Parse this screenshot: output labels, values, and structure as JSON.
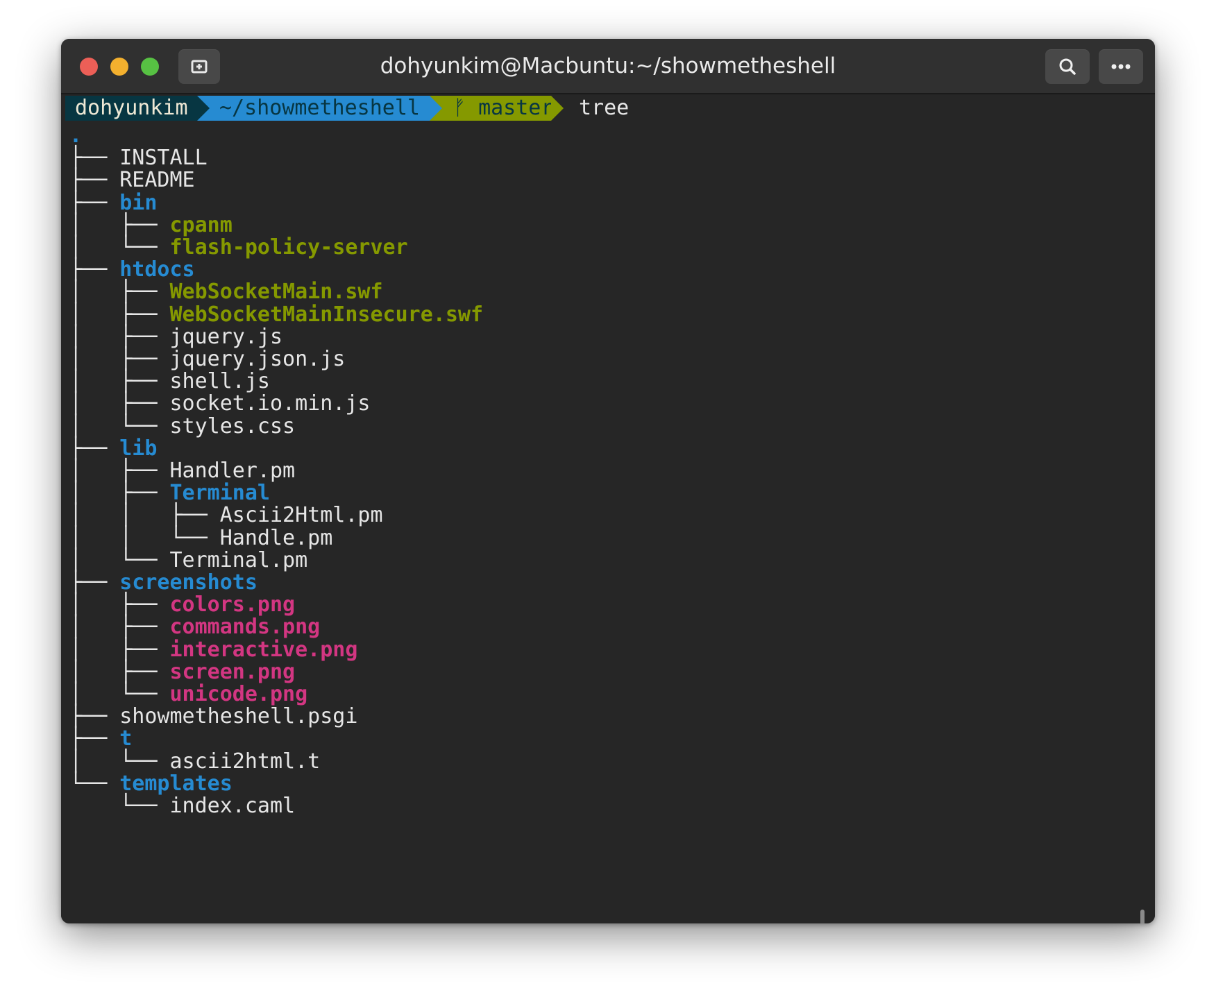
{
  "window": {
    "title": "dohyunkim@Macbuntu:~/showmetheshell"
  },
  "titlebar": {
    "buttons": {
      "close": "red-close-icon",
      "minimize": "yellow-minimize-icon",
      "maximize": "green-maximize-icon",
      "new_tab": "new-tab-icon",
      "search": "search-icon",
      "menu": "more-horizontal-icon"
    }
  },
  "prompt": {
    "user": "dohyunkim",
    "path": "~/showmetheshell",
    "branch_icon": "ᚠ",
    "branch": "master",
    "command": "tree"
  },
  "colors": {
    "directory": "#268bd2",
    "executable": "#859900",
    "image": "#d33682",
    "file": "#e6e6e6"
  },
  "tree": [
    {
      "prefix": ".",
      "name": "",
      "kind": "dir"
    },
    {
      "prefix": "├── ",
      "name": "INSTALL",
      "kind": "file"
    },
    {
      "prefix": "├── ",
      "name": "README",
      "kind": "file"
    },
    {
      "prefix": "├── ",
      "name": "bin",
      "kind": "dir"
    },
    {
      "prefix": "│   ├── ",
      "name": "cpanm",
      "kind": "exec"
    },
    {
      "prefix": "│   └── ",
      "name": "flash-policy-server",
      "kind": "exec"
    },
    {
      "prefix": "├── ",
      "name": "htdocs",
      "kind": "dir"
    },
    {
      "prefix": "│   ├── ",
      "name": "WebSocketMain.swf",
      "kind": "exec"
    },
    {
      "prefix": "│   ├── ",
      "name": "WebSocketMainInsecure.swf",
      "kind": "exec"
    },
    {
      "prefix": "│   ├── ",
      "name": "jquery.js",
      "kind": "file"
    },
    {
      "prefix": "│   ├── ",
      "name": "jquery.json.js",
      "kind": "file"
    },
    {
      "prefix": "│   ├── ",
      "name": "shell.js",
      "kind": "file"
    },
    {
      "prefix": "│   ├── ",
      "name": "socket.io.min.js",
      "kind": "file"
    },
    {
      "prefix": "│   └── ",
      "name": "styles.css",
      "kind": "file"
    },
    {
      "prefix": "├── ",
      "name": "lib",
      "kind": "dir"
    },
    {
      "prefix": "│   ├── ",
      "name": "Handler.pm",
      "kind": "file"
    },
    {
      "prefix": "│   ├── ",
      "name": "Terminal",
      "kind": "dir"
    },
    {
      "prefix": "│   │   ├── ",
      "name": "Ascii2Html.pm",
      "kind": "file"
    },
    {
      "prefix": "│   │   └── ",
      "name": "Handle.pm",
      "kind": "file"
    },
    {
      "prefix": "│   └── ",
      "name": "Terminal.pm",
      "kind": "file"
    },
    {
      "prefix": "├── ",
      "name": "screenshots",
      "kind": "dir"
    },
    {
      "prefix": "│   ├── ",
      "name": "colors.png",
      "kind": "img"
    },
    {
      "prefix": "│   ├── ",
      "name": "commands.png",
      "kind": "img"
    },
    {
      "prefix": "│   ├── ",
      "name": "interactive.png",
      "kind": "img"
    },
    {
      "prefix": "│   ├── ",
      "name": "screen.png",
      "kind": "img"
    },
    {
      "prefix": "│   └── ",
      "name": "unicode.png",
      "kind": "img"
    },
    {
      "prefix": "├── ",
      "name": "showmetheshell.psgi",
      "kind": "file"
    },
    {
      "prefix": "├── ",
      "name": "t",
      "kind": "dir"
    },
    {
      "prefix": "│   └── ",
      "name": "ascii2html.t",
      "kind": "file"
    },
    {
      "prefix": "└── ",
      "name": "templates",
      "kind": "dir"
    },
    {
      "prefix": "    └── ",
      "name": "index.caml",
      "kind": "file"
    }
  ]
}
